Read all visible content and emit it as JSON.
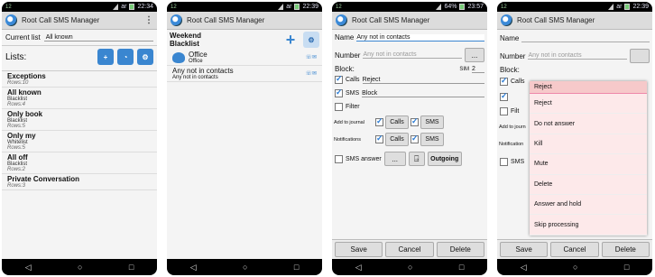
{
  "app_title": "Root Call SMS Manager",
  "status": {
    "s1": "22:34",
    "s2": "22:39",
    "s3": "23:57",
    "s4": "22:39",
    "battery3": "64%",
    "carrier": "ar",
    "notif": "12",
    "sf": "SF"
  },
  "screen1": {
    "current_list_label": "Current list",
    "current_list_value": "All known",
    "lists_label": "Lists:",
    "items": [
      {
        "title": "Exceptions",
        "sub": "",
        "rows": "Rows:10"
      },
      {
        "title": "All known",
        "sub": "Blacklist",
        "rows": "Rows:4"
      },
      {
        "title": "Only book",
        "sub": "Blacklist",
        "rows": "Rows:5"
      },
      {
        "title": "Only my",
        "sub": "Whitelist",
        "rows": "Rows:5"
      },
      {
        "title": "All off",
        "sub": "Blacklist",
        "rows": "Rows:2"
      },
      {
        "title": "Private Conversation",
        "sub": "",
        "rows": "Rows:3"
      }
    ]
  },
  "screen2": {
    "header_line1": "Weekend",
    "header_line2": "Blacklist",
    "items": [
      {
        "title": "Office",
        "sub": "Office"
      },
      {
        "title": "Any not in contacts",
        "sub": "Any not in contacts"
      }
    ]
  },
  "screen3": {
    "name_label": "Name",
    "name_value": "Any not in contacts",
    "number_label": "Number",
    "number_placeholder": "Any not in contacts",
    "dots": "...",
    "block_label": "Block:",
    "sim_label": "SIM",
    "sim_value": "2",
    "calls_label": "Calls",
    "calls_value": "Reject",
    "sms_label": "SMS",
    "sms_value": "Block",
    "filter_label": "Filter",
    "journal_label": "Add to journal",
    "notif_label": "Notifications",
    "calls_btn": "Calls",
    "sms_btn": "SMS",
    "sms_answer_label": "SMS answer",
    "outgoing_btn": "Outgoing",
    "save": "Save",
    "cancel": "Cancel",
    "delete": "Delete"
  },
  "screen4": {
    "name_label": "Name",
    "number_label": "Number",
    "number_placeholder": "Any not in contacts",
    "block_label": "Block:",
    "calls_label": "Calls",
    "filter_label": "Filt",
    "journal_label": "Add to journ",
    "notif_label": "Notification",
    "sms_label": "SMS",
    "menu_selected": "Reject",
    "menu_options": [
      "Reject",
      "Do not answer",
      "Kill",
      "Mute",
      "Delete",
      "Answer and hold",
      "Skip processing"
    ],
    "save": "Save",
    "cancel": "Cancel",
    "delete": "Delete"
  }
}
